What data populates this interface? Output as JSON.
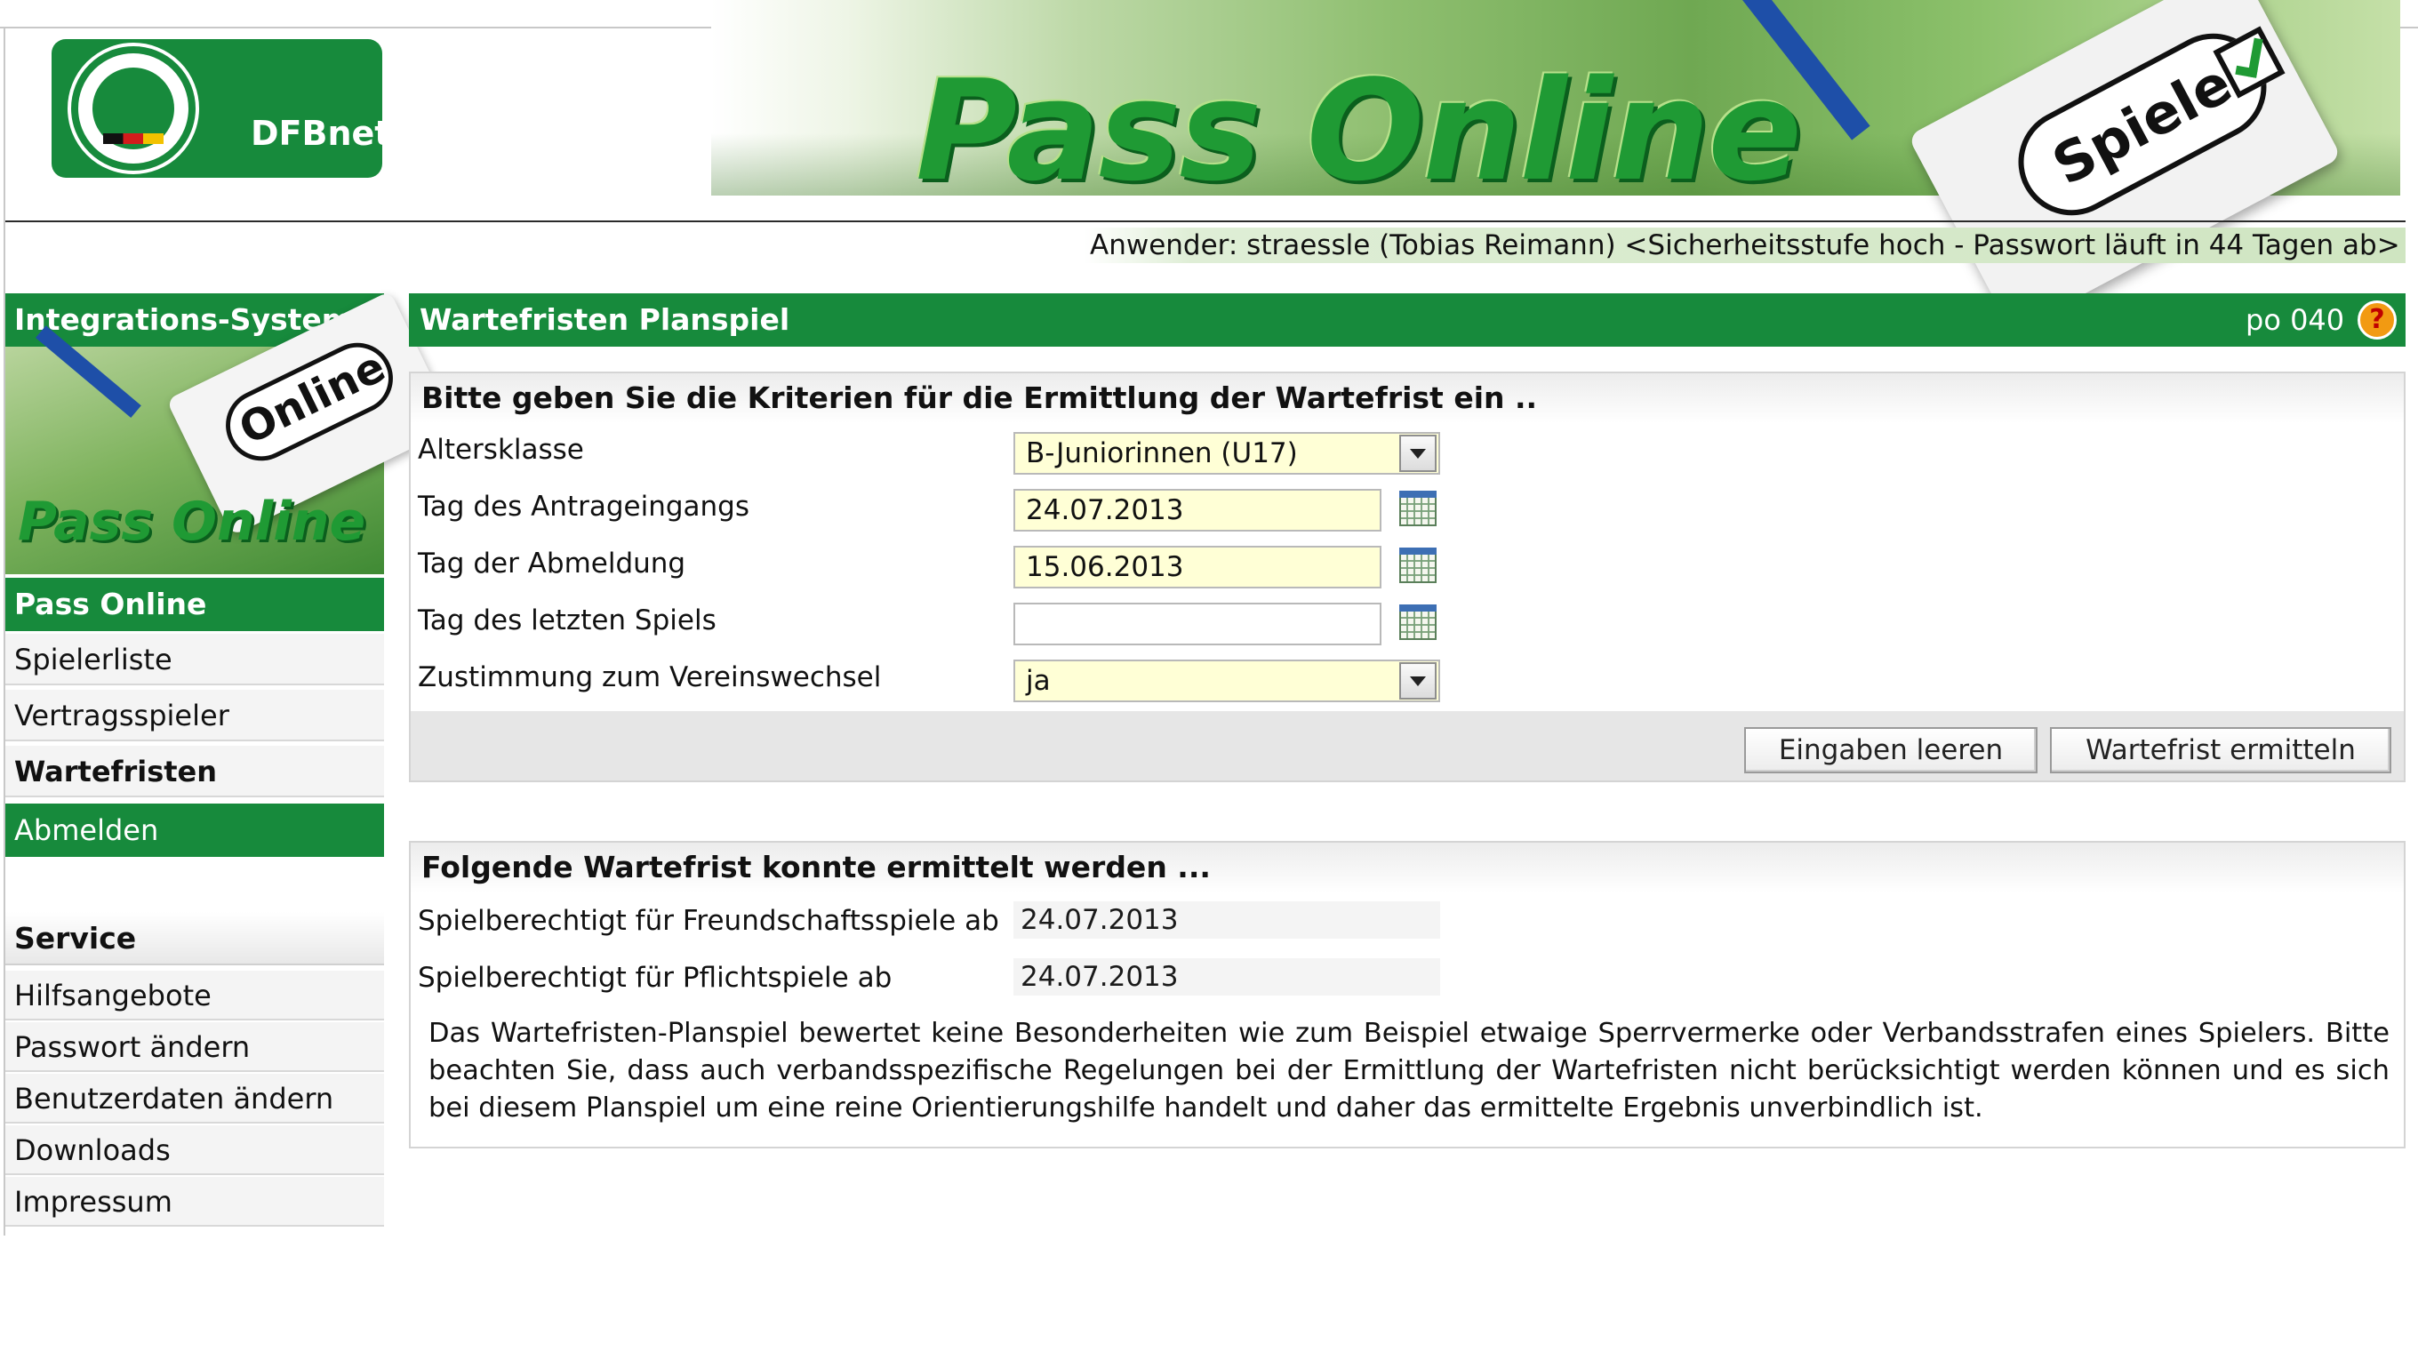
{
  "header": {
    "logo_text": "DFBnet",
    "brand_title": "Pass Online",
    "badge_text": "Spieler",
    "user_info": "Anwender: straessle (Tobias Reimann) <Sicherheitsstufe hoch - Passwort läuft in 44 Tagen ab>"
  },
  "sidebar": {
    "section_title": "Integrations-System",
    "promo": {
      "card_text": "Online",
      "title": "Pass Online"
    },
    "nav_title": "Pass Online",
    "nav_items": [
      {
        "label": "Spielerliste"
      },
      {
        "label": "Vertragsspieler"
      },
      {
        "label": "Wartefristen"
      },
      {
        "label": "Abmelden"
      }
    ],
    "service_title": "Service",
    "service_items": [
      {
        "label": "Hilfsangebote"
      },
      {
        "label": "Passwort ändern"
      },
      {
        "label": "Benutzerdaten ändern"
      },
      {
        "label": "Downloads"
      },
      {
        "label": "Impressum"
      }
    ]
  },
  "main": {
    "title": "Wartefristen Planspiel",
    "page_code": "po 040",
    "help_glyph": "?",
    "criteria": {
      "heading": "Bitte geben Sie die Kriterien für die Ermittlung der Wartefrist ein ..",
      "fields": [
        {
          "label": "Altersklasse",
          "value": "B-Juniorinnen (U17)"
        },
        {
          "label": "Tag des Antrageingangs",
          "value": "24.07.2013"
        },
        {
          "label": "Tag der Abmeldung",
          "value": "15.06.2013"
        },
        {
          "label": "Tag des letzten Spiels",
          "value": ""
        },
        {
          "label": "Zustimmung zum Vereinswechsel",
          "value": "ja"
        }
      ],
      "buttons": {
        "clear": "Eingaben leeren",
        "submit": "Wartefrist ermitteln"
      }
    },
    "result": {
      "heading": "Folgende Wartefrist konnte ermittelt werden ...",
      "rows": [
        {
          "label": "Spielberechtigt für Freundschaftsspiele ab",
          "value": "24.07.2013"
        },
        {
          "label": "Spielberechtigt für Pflichtspiele ab",
          "value": "24.07.2013"
        }
      ],
      "disclaimer": "Das Wartefristen-Planspiel bewertet keine Besonderheiten wie zum Beispiel etwaige Sperrvermerke oder Verbandsstrafen eines Spielers. Bitte beachten Sie, dass auch verbandsspezifische Regelungen bei der Ermittlung der Wartefristen nicht berücksichtigt werden können und es sich bei diesem Planspiel um eine reine Orientierungshilfe handelt und daher das ermittelte Ergebnis unverbindlich ist."
    }
  },
  "colors": {
    "brand_green": "#178a3c",
    "field_yellow": "#ffffd6",
    "help_orange": "#f29a12"
  },
  "icons": [
    "dfb-logo-icon",
    "calendar-icon",
    "chevron-down-icon",
    "help-icon",
    "check-icon"
  ]
}
